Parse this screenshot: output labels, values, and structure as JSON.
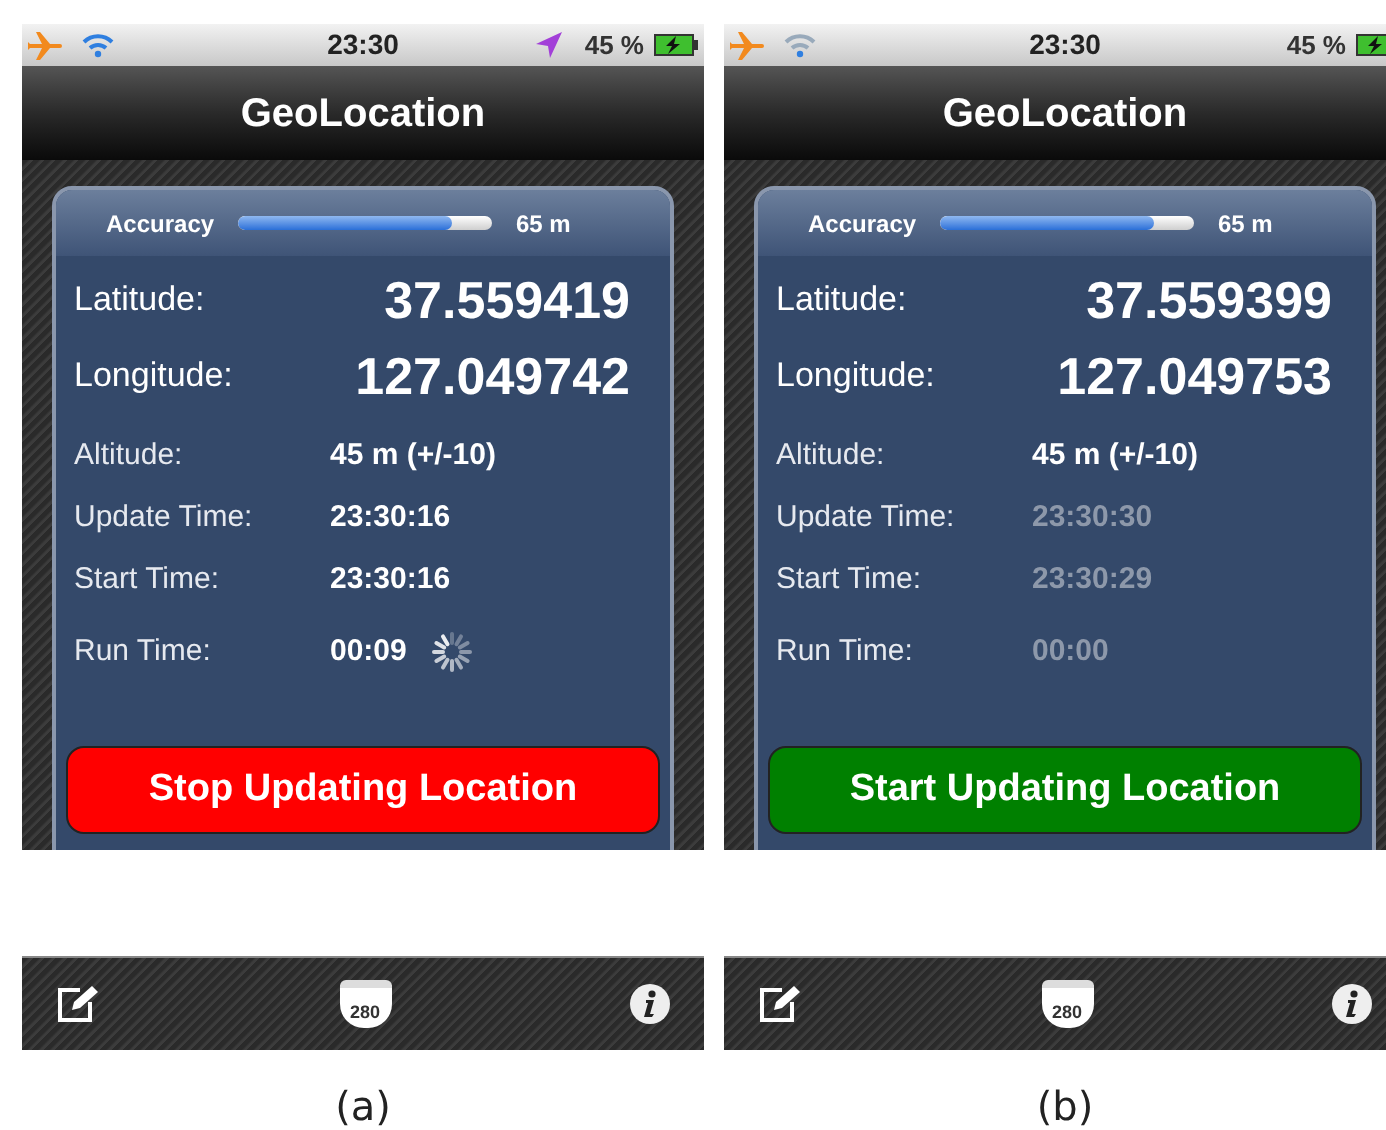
{
  "screens": [
    {
      "status_bar": {
        "time": "23:30",
        "battery": "45 %",
        "location_active": true
      },
      "title": "GeoLocation",
      "accuracy": {
        "label": "Accuracy",
        "level": 0.84,
        "reading": "65 m"
      },
      "coordinates": [
        {
          "label": "Latitude:",
          "value": "37.559419"
        },
        {
          "label": "Longitude:",
          "value": "127.049742"
        }
      ],
      "details": [
        {
          "label": "Altitude:",
          "value": "45 m (+/-10)",
          "dimmed": false
        },
        {
          "label": "Update Time:",
          "value": "23:30:16",
          "dimmed": false
        },
        {
          "label": "Start Time:",
          "value": "23:30:16",
          "dimmed": false
        },
        {
          "label": "Run Time:",
          "value": "00:09",
          "dimmed": false
        }
      ],
      "busy": true,
      "button": {
        "label": "Stop Updating Location",
        "kind": "stop"
      },
      "toolbar": {
        "shield_label": "280"
      },
      "caption": "(a)"
    },
    {
      "status_bar": {
        "time": "23:30",
        "battery": "45 %",
        "location_active": false
      },
      "title": "GeoLocation",
      "accuracy": {
        "label": "Accuracy",
        "level": 0.84,
        "reading": "65 m"
      },
      "coordinates": [
        {
          "label": "Latitude:",
          "value": "37.559399"
        },
        {
          "label": "Longitude:",
          "value": "127.049753"
        }
      ],
      "details": [
        {
          "label": "Altitude:",
          "value": "45 m (+/-10)",
          "dimmed": false
        },
        {
          "label": "Update Time:",
          "value": "23:30:30",
          "dimmed": true
        },
        {
          "label": "Start Time:",
          "value": "23:30:29",
          "dimmed": true
        },
        {
          "label": "Run Time:",
          "value": "00:00",
          "dimmed": true
        }
      ],
      "busy": false,
      "button": {
        "label": "Start Updating Location",
        "kind": "start"
      },
      "toolbar": {
        "shield_label": "280"
      },
      "caption": "(b)"
    }
  ]
}
